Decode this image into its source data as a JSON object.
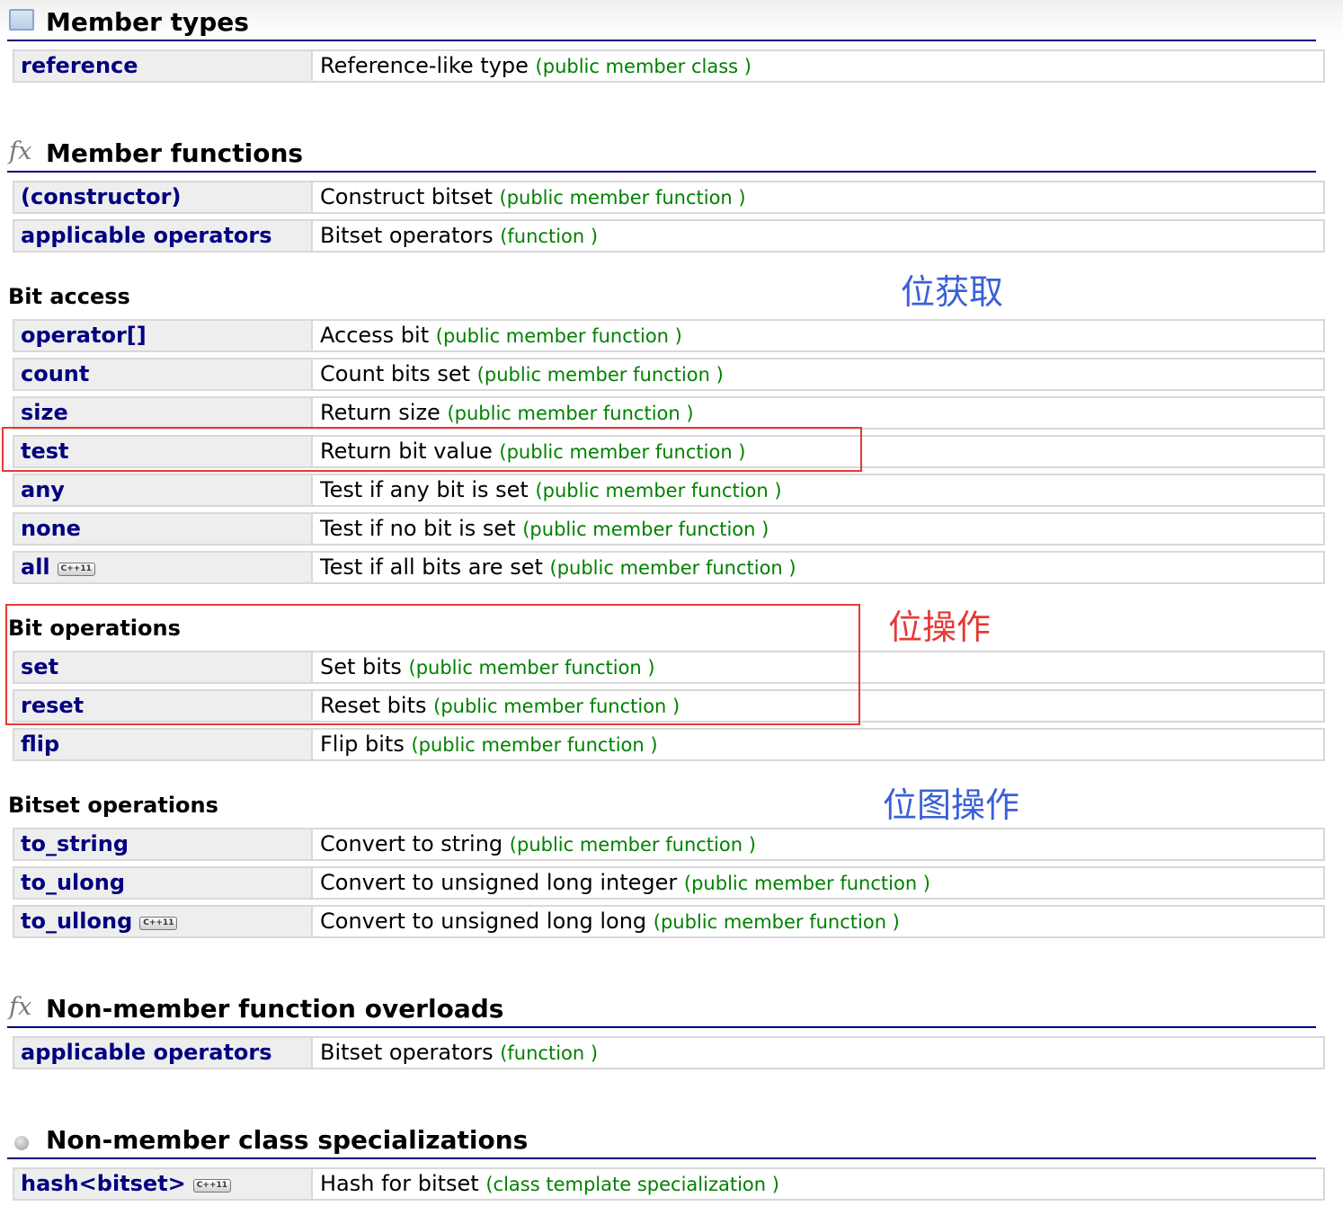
{
  "sections": {
    "member_types": {
      "title": "Member types",
      "icon": "document-icon"
    },
    "member_functions": {
      "title": "Member functions",
      "icon": "fx-icon"
    },
    "non_member_overloads": {
      "title": "Non-member function overloads",
      "icon": "fx-icon"
    },
    "non_member_specializations": {
      "title": "Non-member class specializations",
      "icon": "bullet-icon"
    }
  },
  "subsections": {
    "bit_access": "Bit access",
    "bit_operations": "Bit operations",
    "bitset_operations": "Bitset operations"
  },
  "fx_glyph": "fx",
  "cpp11_badge": "C++11",
  "rows": {
    "reference": {
      "name": "reference",
      "desc": "Reference-like type",
      "kind": "(public member class )"
    },
    "constructor": {
      "name": "(constructor)",
      "desc": "Construct bitset",
      "kind": "(public member function )"
    },
    "applicable_operators": {
      "name": "applicable operators",
      "desc": "Bitset operators",
      "kind": "(function )"
    },
    "operator_index": {
      "name": "operator[]",
      "desc": "Access bit",
      "kind": "(public member function )"
    },
    "count": {
      "name": "count",
      "desc": "Count bits set",
      "kind": "(public member function )"
    },
    "size": {
      "name": "size",
      "desc": "Return size",
      "kind": "(public member function )"
    },
    "test": {
      "name": "test",
      "desc": "Return bit value",
      "kind": "(public member function )"
    },
    "any": {
      "name": "any",
      "desc": "Test if any bit is set",
      "kind": "(public member function )"
    },
    "none": {
      "name": "none",
      "desc": "Test if no bit is set",
      "kind": "(public member function )"
    },
    "all": {
      "name": "all",
      "desc": "Test if all bits are set",
      "kind": "(public member function )"
    },
    "set": {
      "name": "set",
      "desc": "Set bits",
      "kind": "(public member function )"
    },
    "reset": {
      "name": "reset",
      "desc": "Reset bits",
      "kind": "(public member function )"
    },
    "flip": {
      "name": "flip",
      "desc": "Flip bits",
      "kind": "(public member function )"
    },
    "to_string": {
      "name": "to_string",
      "desc": "Convert to string",
      "kind": "(public member function )"
    },
    "to_ulong": {
      "name": "to_ulong",
      "desc": "Convert to unsigned long integer",
      "kind": "(public member function )"
    },
    "to_ullong": {
      "name": "to_ullong",
      "desc": "Convert to unsigned long long",
      "kind": "(public member function )"
    },
    "nm_applicable_operators": {
      "name": "applicable operators",
      "desc": "Bitset operators",
      "kind": "(function )"
    },
    "hash": {
      "name": "hash<bitset>",
      "desc": "Hash for bitset",
      "kind": "(class template specialization )"
    }
  },
  "annotations": {
    "bit_get": "位获取",
    "bit_op": "位操作",
    "bitmap_op": "位图操作"
  },
  "colors": {
    "link": "#000080",
    "kind": "#008000",
    "highlight_box": "#e53935",
    "note_blue": "#3a5fd6",
    "note_red": "#e53935"
  }
}
